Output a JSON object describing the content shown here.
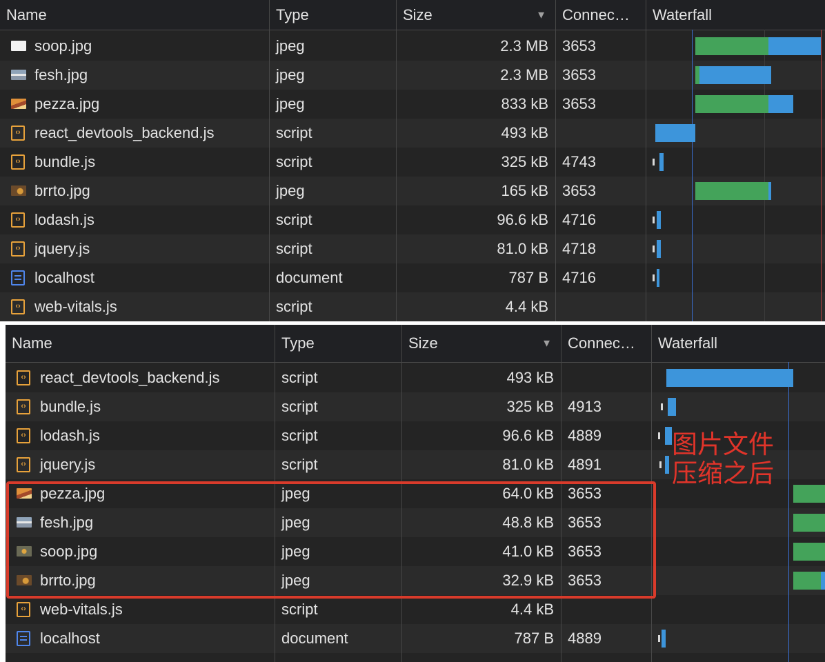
{
  "columns": {
    "name": "Name",
    "type": "Type",
    "size": "Size",
    "connection": "Connec…",
    "waterfall": "Waterfall",
    "sort_indicator": "▼"
  },
  "panel_before": {
    "rows": [
      {
        "name": "soop.jpg",
        "type": "jpeg",
        "size": "2.3 MB",
        "connection": "3653",
        "icon": "image-thumbnail-icon"
      },
      {
        "name": "fesh.jpg",
        "type": "jpeg",
        "size": "2.3 MB",
        "connection": "3653",
        "icon": "image-thumbnail-icon"
      },
      {
        "name": "pezza.jpg",
        "type": "jpeg",
        "size": "833 kB",
        "connection": "3653",
        "icon": "image-thumbnail-icon"
      },
      {
        "name": "react_devtools_backend.js",
        "type": "script",
        "size": "493 kB",
        "connection": "",
        "icon": "script-file-icon"
      },
      {
        "name": "bundle.js",
        "type": "script",
        "size": "325 kB",
        "connection": "4743",
        "icon": "script-file-icon"
      },
      {
        "name": "brrto.jpg",
        "type": "jpeg",
        "size": "165 kB",
        "connection": "3653",
        "icon": "image-thumbnail-icon"
      },
      {
        "name": "lodash.js",
        "type": "script",
        "size": "96.6 kB",
        "connection": "4716",
        "icon": "script-file-icon"
      },
      {
        "name": "jquery.js",
        "type": "script",
        "size": "81.0 kB",
        "connection": "4718",
        "icon": "script-file-icon"
      },
      {
        "name": "localhost",
        "type": "document",
        "size": "787 B",
        "connection": "4716",
        "icon": "document-file-icon"
      },
      {
        "name": "web-vitals.js",
        "type": "script",
        "size": "4.4 kB",
        "connection": "",
        "icon": "script-file-icon"
      }
    ]
  },
  "panel_after": {
    "rows": [
      {
        "name": "react_devtools_backend.js",
        "type": "script",
        "size": "493 kB",
        "connection": "",
        "icon": "script-file-icon"
      },
      {
        "name": "bundle.js",
        "type": "script",
        "size": "325 kB",
        "connection": "4913",
        "icon": "script-file-icon"
      },
      {
        "name": "lodash.js",
        "type": "script",
        "size": "96.6 kB",
        "connection": "4889",
        "icon": "script-file-icon"
      },
      {
        "name": "jquery.js",
        "type": "script",
        "size": "81.0 kB",
        "connection": "4891",
        "icon": "script-file-icon"
      },
      {
        "name": "pezza.jpg",
        "type": "jpeg",
        "size": "64.0 kB",
        "connection": "3653",
        "icon": "image-thumbnail-icon"
      },
      {
        "name": "fesh.jpg",
        "type": "jpeg",
        "size": "48.8 kB",
        "connection": "3653",
        "icon": "image-thumbnail-icon"
      },
      {
        "name": "soop.jpg",
        "type": "jpeg",
        "size": "41.0 kB",
        "connection": "3653",
        "icon": "image-thumbnail-icon"
      },
      {
        "name": "brrto.jpg",
        "type": "jpeg",
        "size": "32.9 kB",
        "connection": "3653",
        "icon": "image-thumbnail-icon"
      },
      {
        "name": "web-vitals.js",
        "type": "script",
        "size": "4.4 kB",
        "connection": "",
        "icon": "script-file-icon"
      },
      {
        "name": "localhost",
        "type": "document",
        "size": "787 B",
        "connection": "4889",
        "icon": "document-file-icon"
      }
    ]
  },
  "annotation": {
    "line1": "图片文件",
    "line2": "压缩之后"
  },
  "colors": {
    "panel_bg": "#242424",
    "row_alt_bg": "#2b2b2b",
    "text": "#e3e3e3",
    "waterfall_green": "#44a35a",
    "waterfall_blue": "#3d95db",
    "highlight_red": "#d93b2b"
  }
}
